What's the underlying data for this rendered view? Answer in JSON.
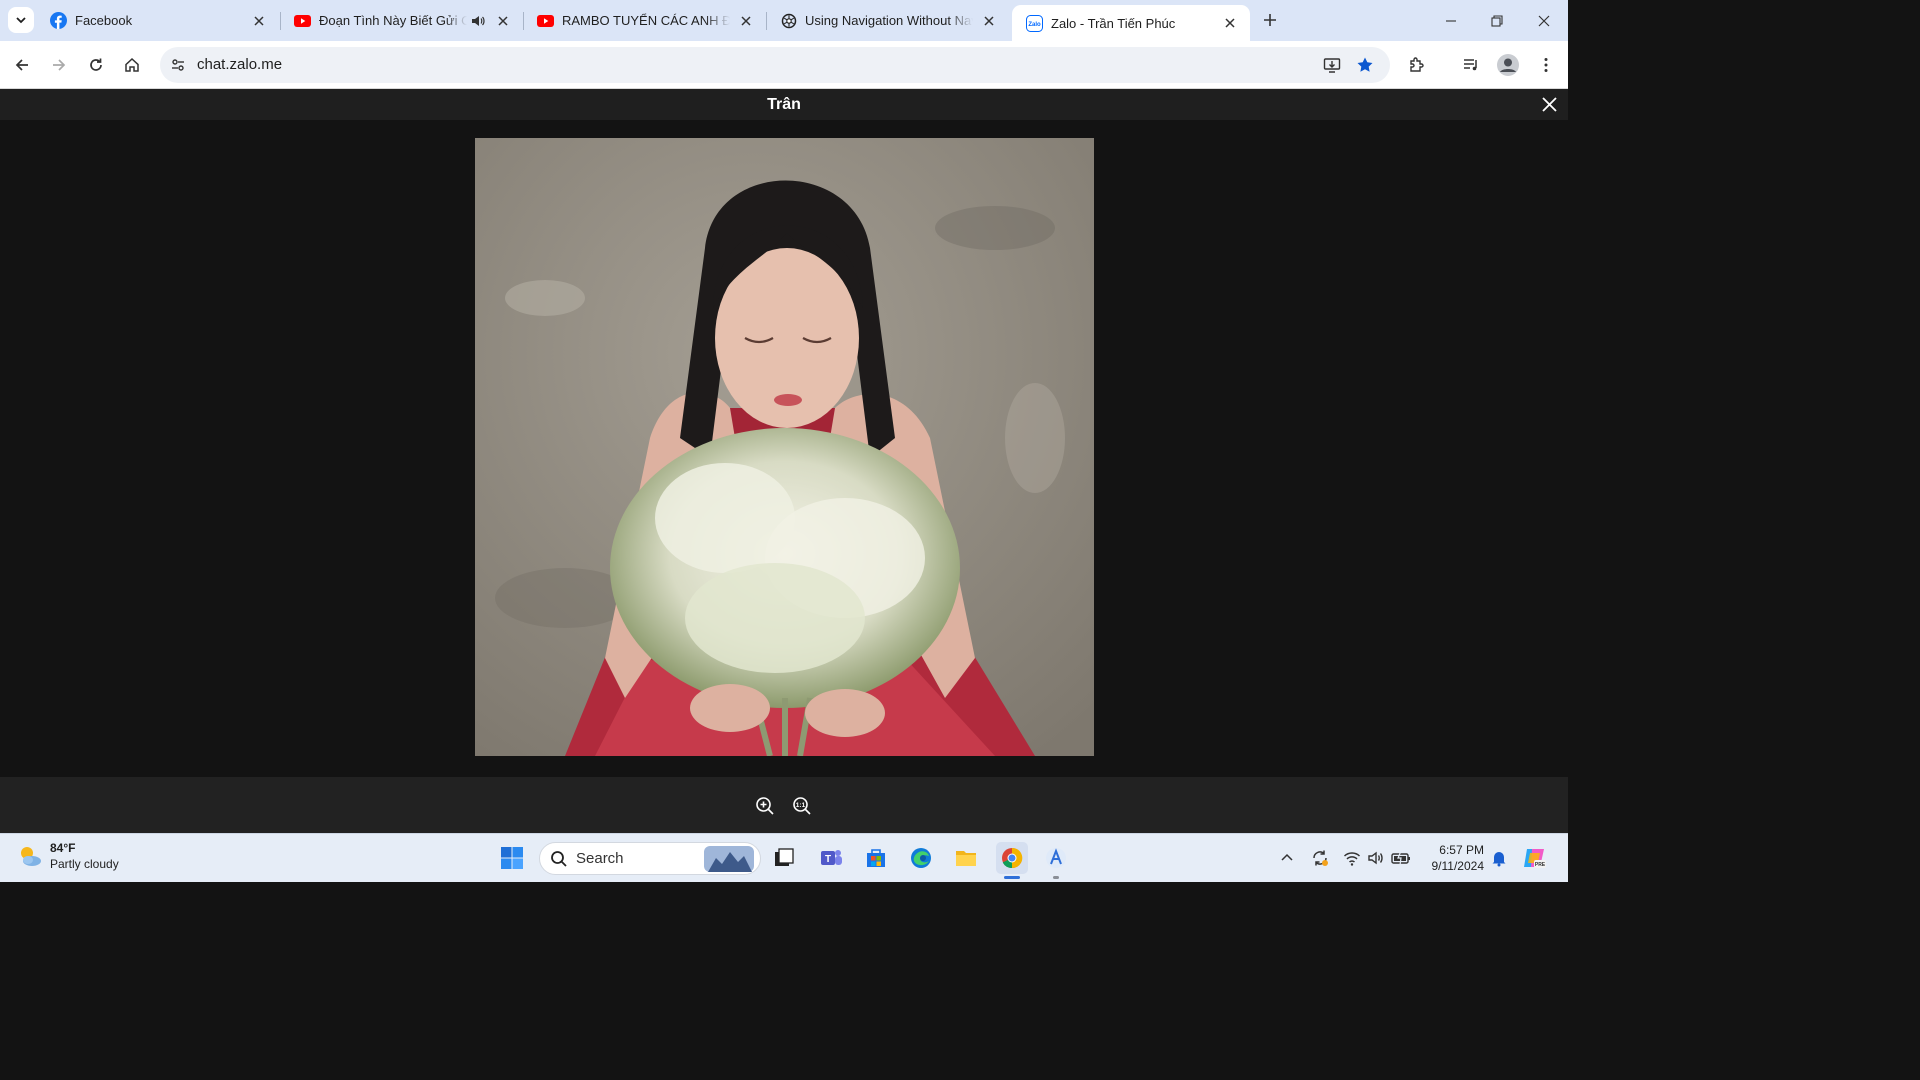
{
  "browser": {
    "tabs": [
      {
        "title": "Facebook",
        "icon": "facebook-icon",
        "color": "#1877f2"
      },
      {
        "title": "Đoạn Tình Này Biết Gửi Cho Ai",
        "icon": "youtube-icon",
        "color": "#ff0000",
        "audio": true
      },
      {
        "title": "RAMBO TUYỂN CÁC ANH ĐẸP TRAI",
        "icon": "youtube-icon",
        "color": "#ff0000"
      },
      {
        "title": "Using Navigation Without NavHost",
        "icon": "openai-icon",
        "color": "#222222"
      },
      {
        "title": "Zalo - Trần Tiến Phúc",
        "icon": "zalo-icon",
        "color": "#0068ff",
        "active": true
      }
    ],
    "url": "chat.zalo.me"
  },
  "viewer": {
    "title": "Trân",
    "photo_subject": "photo",
    "zoom_in_icon": "zoom-in-icon",
    "zoom_reset_icon": "zoom-reset-icon"
  },
  "taskbar": {
    "weather": {
      "temp": "84°F",
      "condition": "Partly cloudy"
    },
    "search_label": "Search",
    "clock": {
      "time": "6:57 PM",
      "date": "9/11/2024"
    }
  },
  "colors": {
    "tabstrip": "#dbe5f7",
    "viewer_bg": "#131313",
    "accent": "#2f6fd8"
  }
}
